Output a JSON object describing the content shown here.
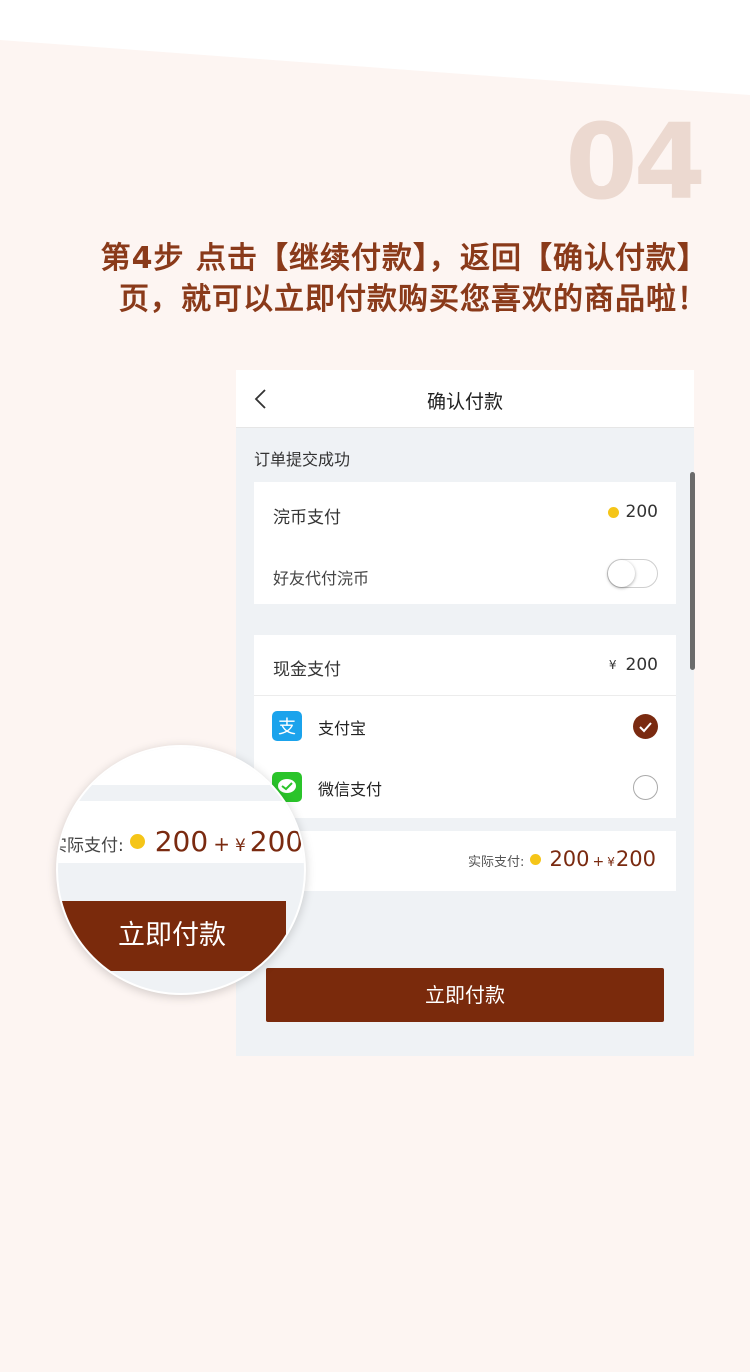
{
  "step": {
    "number": "04",
    "instruction": "第4步 点击【继续付款】，返回【确认付款】页，就可以立即付款购买您喜欢的商品啦！"
  },
  "nav": {
    "title": "确认付款",
    "back_icon": "chevron-left-icon"
  },
  "order_status": "订单提交成功",
  "coin_payment": {
    "label": "浣币支付",
    "amount": "200"
  },
  "friend_pay": {
    "label": "好友代付浣币",
    "enabled": false
  },
  "cash_payment": {
    "label": "现金支付",
    "currency": "¥",
    "amount": "200"
  },
  "payment_methods": [
    {
      "name": "支付宝",
      "icon": "alipay-icon",
      "selected": true
    },
    {
      "name": "微信支付",
      "icon": "wechat-pay-icon",
      "selected": false
    }
  ],
  "total": {
    "label": "实际支付:",
    "coins": "200",
    "plus": "+",
    "currency": "¥",
    "cash": "200"
  },
  "pay_button": "立即付款",
  "colors": {
    "brand": "#7a2a0c",
    "instruction": "#8a3a1a",
    "step_number": "#ecd9d0",
    "coin": "#f5c518"
  }
}
